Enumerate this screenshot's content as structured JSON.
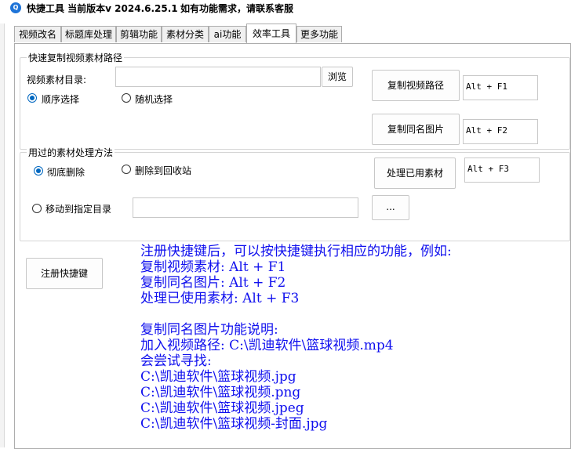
{
  "window": {
    "icon_text": "Q",
    "title": "快捷工具 当前版本v 2024.6.25.1",
    "note": "如有功能需求，请联系客服"
  },
  "tabs": [
    {
      "label": "视频改名"
    },
    {
      "label": "标题库处理"
    },
    {
      "label": "剪辑功能"
    },
    {
      "label": "素材分类"
    },
    {
      "label": "ai功能"
    },
    {
      "label": "效率工具"
    },
    {
      "label": "更多功能"
    }
  ],
  "active_tab": "效率工具",
  "copy_group": {
    "title": "快速复制视频素材路径",
    "dir_label": "视频素材目录:",
    "dir_value": "",
    "browse_label": "浏览",
    "radio_sequential": "顺序选择",
    "radio_random": "随机选择",
    "selected_mode": "顺序选择",
    "copy_video_label": "复制视频路径",
    "copy_video_hotkey": "Alt + F1",
    "copy_image_label": "复制同名图片",
    "copy_image_hotkey": "Alt + F2"
  },
  "process_group": {
    "title": "用过的素材处理方法",
    "radio_delete": "彻底删除",
    "radio_recycle": "删除到回收站",
    "radio_move": "移动到指定目录",
    "selected_method": "彻底删除",
    "move_dir_value": "",
    "pick_dir_label": "...",
    "process_label": "处理已用素材",
    "process_hotkey": "Alt + F3"
  },
  "register_label": "注册快捷键",
  "help_lines": [
    "注册快捷键后，可以按快捷键执行相应的功能，例如:",
    "复制视频素材: Alt + F1",
    "复制同名图片: Alt + F2",
    "处理已使用素材: Alt + F3",
    "",
    "复制同名图片功能说明:",
    "加入视频路径: C:\\凯迪软件\\篮球视频.mp4",
    "会尝试寻找:",
    "C:\\凯迪软件\\篮球视频.jpg",
    "C:\\凯迪软件\\篮球视频.png",
    "C:\\凯迪软件\\篮球视频.jpeg",
    "C:\\凯迪软件\\篮球视频-封面.jpg"
  ],
  "colors": {
    "accent": "#0067c0",
    "help_text": "#1010ee"
  }
}
